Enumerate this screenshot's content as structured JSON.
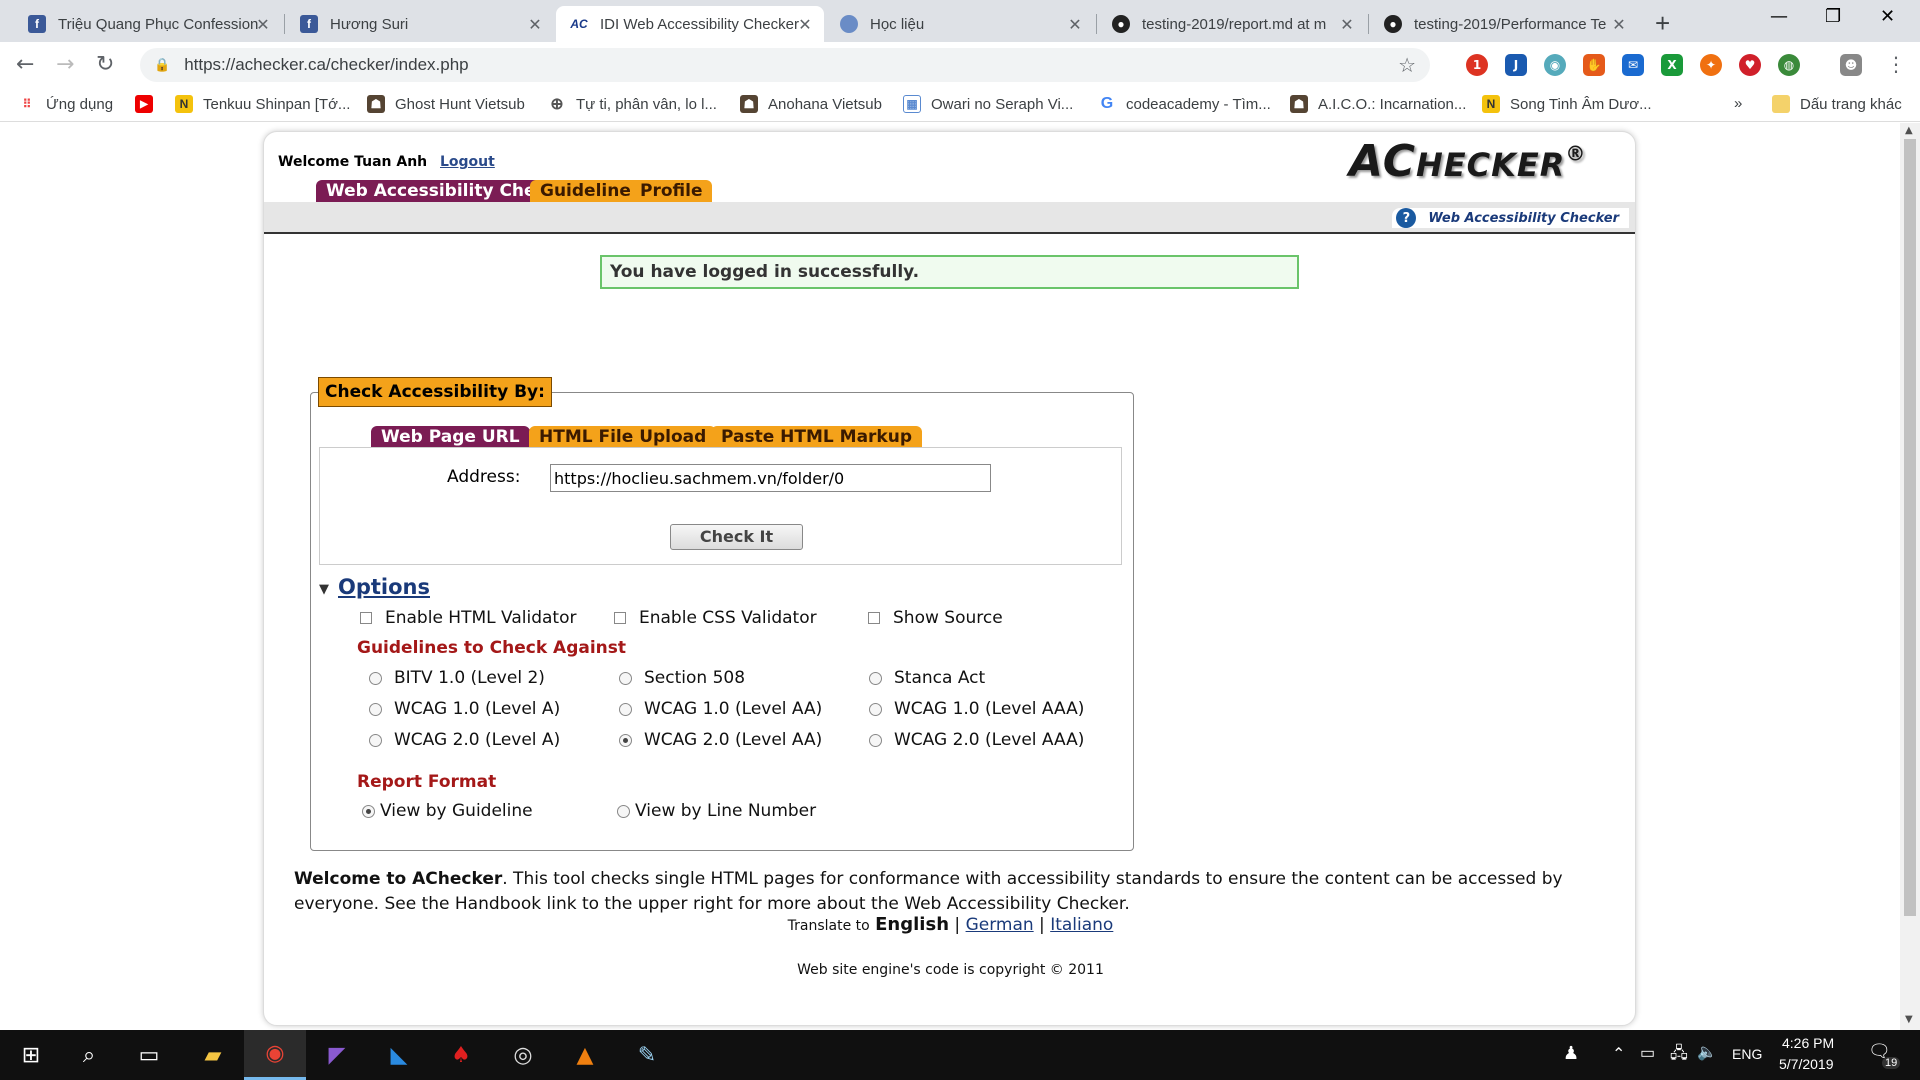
{
  "browser": {
    "tabs": [
      {
        "title": "Triệu Quang Phục Confession",
        "icon": "facebook-icon"
      },
      {
        "title": "Hương Suri",
        "icon": "facebook-icon"
      },
      {
        "title": "IDI Web Accessibility Checker",
        "icon": "achecker-icon",
        "active": true
      },
      {
        "title": "Học liệu",
        "icon": "hoclieu-icon"
      },
      {
        "title": "testing-2019/report.md at m",
        "icon": "github-icon"
      },
      {
        "title": "testing-2019/Performance Te",
        "icon": "github-icon"
      }
    ],
    "url": "https://achecker.ca/checker/index.php",
    "extension_badge": "1",
    "bookmarks": [
      {
        "label": "Ứng dụng",
        "icon": "apps-grid-icon"
      },
      {
        "label": "",
        "icon": "youtube-icon"
      },
      {
        "label": "Tenkuu Shinpan [Tớ...",
        "icon": "n-icon"
      },
      {
        "label": "Ghost Hunt Vietsub",
        "icon": "anime-icon"
      },
      {
        "label": "Tự ti, phân vân, lo l...",
        "icon": "globe-icon"
      },
      {
        "label": "Anohana Vietsub",
        "icon": "anime-icon"
      },
      {
        "label": "Owari no Seraph Vi...",
        "icon": "page-icon"
      },
      {
        "label": "codeacademy - Tìm...",
        "icon": "google-icon"
      },
      {
        "label": "A.I.C.O.: Incarnation...",
        "icon": "anime-icon"
      },
      {
        "label": "Song Tinh Âm Dươ...",
        "icon": "n-icon"
      }
    ],
    "overflow": "»",
    "other_bookmarks": "Dấu trang khác"
  },
  "site": {
    "welcome": "Welcome Tuan Anh",
    "logout": "Logout",
    "logo": {
      "a": "A",
      "c": "C",
      "rest": "HECKER",
      "reg": "®"
    },
    "nav": [
      "Web Accessibility Checker",
      "Guidelines",
      "Profile"
    ],
    "handbook": "Web Accessibility Checker",
    "success": "You have logged in successfully.",
    "check_legend": "Check Accessibility By:",
    "check_tabs": [
      "Web Page URL",
      "HTML File Upload",
      "Paste HTML Markup"
    ],
    "address_label": "Address:",
    "address_value": "https://hoclieu.sachmem.vn/folder/0",
    "check_button": "Check It",
    "options_label": "Options",
    "options": [
      {
        "label": "Enable HTML Validator",
        "checked": false
      },
      {
        "label": "Enable CSS Validator",
        "checked": false
      },
      {
        "label": "Show Source",
        "checked": false
      }
    ],
    "guidelines_heading": "Guidelines to Check Against",
    "guidelines": [
      {
        "label": "BITV 1.0 (Level 2)",
        "selected": false
      },
      {
        "label": "Section 508",
        "selected": false
      },
      {
        "label": "Stanca Act",
        "selected": false
      },
      {
        "label": "WCAG 1.0 (Level A)",
        "selected": false
      },
      {
        "label": "WCAG 1.0 (Level AA)",
        "selected": false
      },
      {
        "label": "WCAG 1.0 (Level AAA)",
        "selected": false
      },
      {
        "label": "WCAG 2.0 (Level A)",
        "selected": false
      },
      {
        "label": "WCAG 2.0 (Level AA)",
        "selected": true
      },
      {
        "label": "WCAG 2.0 (Level AAA)",
        "selected": false
      }
    ],
    "report_heading": "Report Format",
    "report_formats": [
      {
        "label": "View by Guideline",
        "selected": true
      },
      {
        "label": "View by Line Number",
        "selected": false
      }
    ],
    "welcome_bold": "Welcome to AChecker",
    "welcome_text": ". This tool checks single HTML pages for conformance with accessibility standards to ensure the content can be accessed by everyone. See the Handbook link to the upper right for more about the Web Accessibility Checker.",
    "translate_label": "Translate to",
    "translate_current": "English",
    "translate_links": [
      "German",
      "Italiano"
    ],
    "separator": "|",
    "footer": "Web site engine's code is copyright © 2011"
  },
  "taskbar": {
    "apps": [
      "start-icon",
      "search-icon",
      "task-view-icon",
      "file-explorer-icon",
      "chrome-icon",
      "visual-studio-icon",
      "vscode-icon",
      "garena-icon",
      "obs-icon",
      "vlc-icon",
      "paint-icon"
    ],
    "language": "ENG",
    "time": "4:26 PM",
    "date": "5/7/2019",
    "notifications": "19"
  },
  "colors": {
    "nav_selected": "#7b1c54",
    "nav_unselected": "#f4a21a",
    "heading_red": "#a41818",
    "link_blue": "#1a3a7a"
  }
}
